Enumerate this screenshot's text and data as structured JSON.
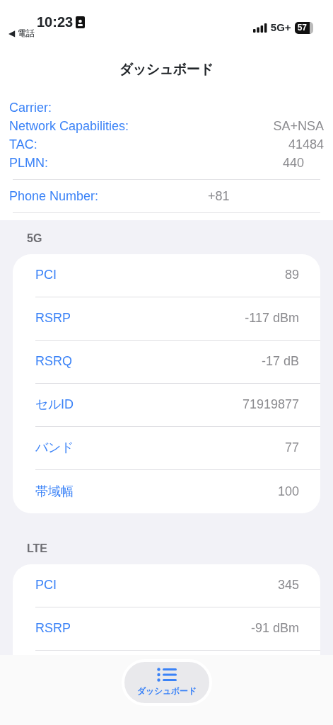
{
  "status_bar": {
    "time": "10:23",
    "back": "◀ 電話",
    "network": "5G+",
    "battery": "57"
  },
  "title": "ダッシュボード",
  "info": [
    {
      "label": "Carrier:"
    },
    {
      "label": "Network Capabilities:",
      "value": "SA+NSA"
    },
    {
      "label": "TAC:",
      "value": "41484"
    },
    {
      "label": "PLMN:",
      "value": "440"
    }
  ],
  "phone": {
    "label": "Phone Number:",
    "value": "+81"
  },
  "sections": [
    {
      "header": "5G",
      "rows": [
        {
          "label": "PCI",
          "value": "89"
        },
        {
          "label": "RSRP",
          "value": "-117 dBm"
        },
        {
          "label": "RSRQ",
          "value": "-17 dB"
        },
        {
          "label": "セルID",
          "value": "71919877"
        },
        {
          "label": "バンド",
          "value": "77"
        },
        {
          "label": "帯域幅",
          "value": "100"
        }
      ]
    },
    {
      "header": "LTE",
      "rows": [
        {
          "label": "PCI",
          "value": "345"
        },
        {
          "label": "RSRP",
          "value": "-91 dBm"
        }
      ]
    }
  ],
  "tab_bar": [
    {
      "label": "ダッシュボード",
      "selected": true
    }
  ]
}
